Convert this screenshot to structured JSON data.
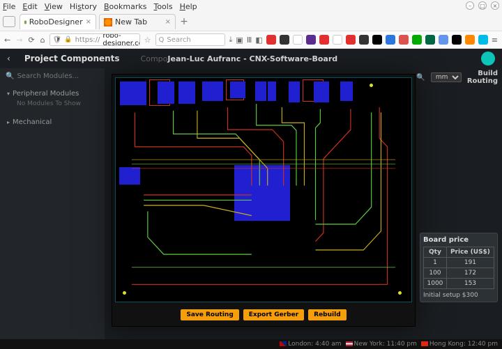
{
  "menubar": {
    "items": [
      "File",
      "Edit",
      "View",
      "History",
      "Bookmarks",
      "Tools",
      "Help"
    ]
  },
  "tabs": {
    "t0": {
      "label": "RoboDesigner"
    },
    "t1": {
      "label": "New Tab"
    }
  },
  "urlbar": {
    "scheme": "https://",
    "domain": "robo-designer.com"
  },
  "search": {
    "placeholder": "Search"
  },
  "ext_colors": [
    "#e03030",
    "#333333",
    "#ffffff",
    "#5c2d91",
    "#e03030",
    "#ffffff",
    "#e03030",
    "#333333",
    "#000000",
    "#2c76dd",
    "#d9534f",
    "#00aa00",
    "#006400",
    "#6495ed",
    "#000000",
    "#ff8800",
    "#00bde7"
  ],
  "app": {
    "header_title": "Project Components",
    "breadcrumb_prefix": "Compo",
    "breadcrumb_project": "Jean-Luc Aufranc - CNX-Software-Board",
    "build_routing_l1": "Build",
    "build_routing_l2": "Routing",
    "unit_selected": "mm"
  },
  "sidebar": {
    "search_placeholder": "Search Modules...",
    "group1": "Peripheral Modules",
    "group1_empty": "No Modules To Show",
    "group2": "Mechanical"
  },
  "modal": {
    "btn_save": "Save Routing",
    "btn_gerber": "Export Gerber",
    "btn_rebuild": "Rebuild"
  },
  "price": {
    "title": "Board price",
    "col_qty": "Qty",
    "col_price": "Price (US$)",
    "rows": [
      {
        "qty": "1",
        "price": "191"
      },
      {
        "qty": "100",
        "price": "172"
      },
      {
        "qty": "1000",
        "price": "153"
      }
    ],
    "setup": "Initial setup $300"
  },
  "status": {
    "london": "London: 4:40 am",
    "ny": "New York: 11:40 pm",
    "hk": "Hong Kong: 12:40 pm"
  }
}
